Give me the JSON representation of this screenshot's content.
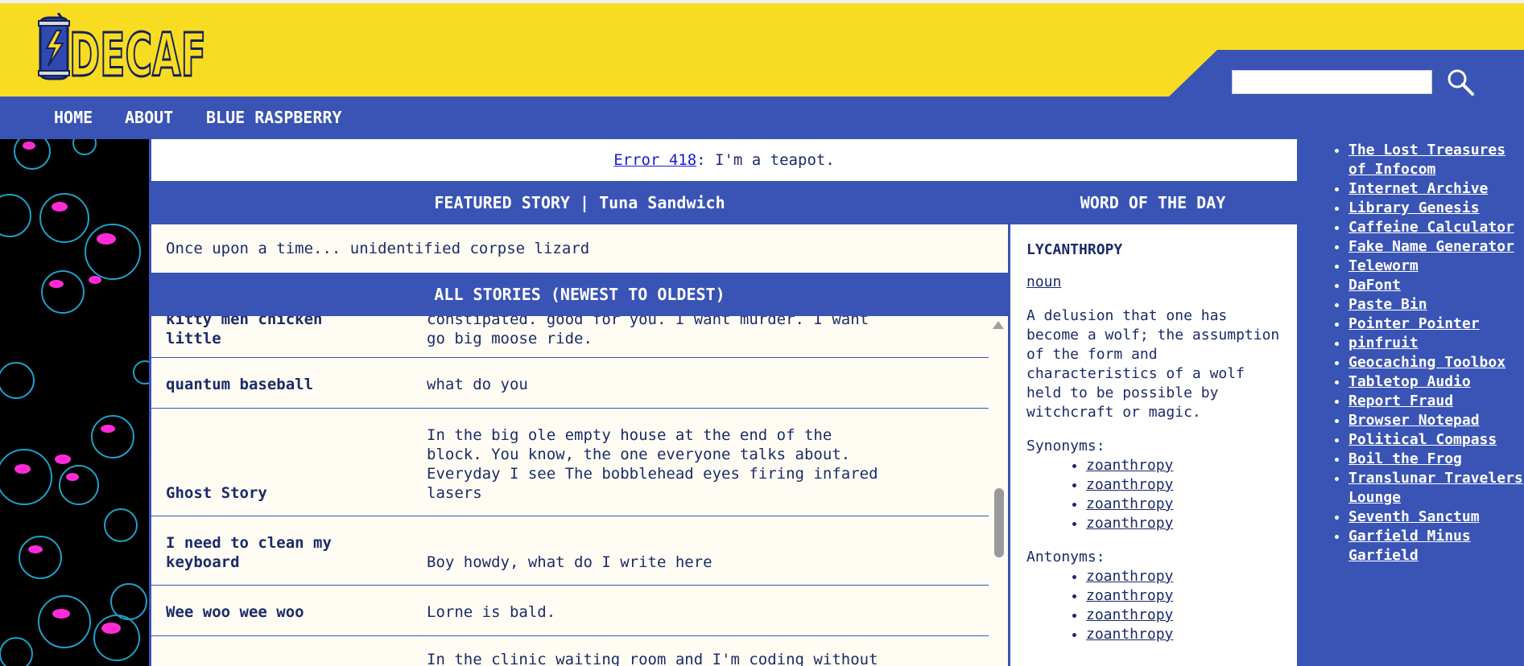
{
  "colors": {
    "yellow": "#f7dc22",
    "blue": "#3a54b5",
    "cream": "#fffdf3",
    "ink": "#1c2a6b"
  },
  "header": {
    "logo_text": "DECAF",
    "search_placeholder": "",
    "search_icon": "search-icon"
  },
  "nav": {
    "items": [
      "HOME",
      "ABOUT",
      "BLUE RASPBERRY"
    ]
  },
  "notice": {
    "link": "Error 418",
    "text": ": I'm a teapot."
  },
  "featured": {
    "heading": "FEATURED STORY | Tuna Sandwich",
    "text": "Once upon a time... unidentified corpse lizard"
  },
  "all_stories": {
    "heading": "ALL STORIES (NEWEST TO OLDEST)",
    "rows": [
      {
        "title": "kitty men chicken\nlittle",
        "text": "constipated. good for you. I want murder. I want\ngo big moose ride."
      },
      {
        "title": "quantum baseball",
        "text": "what do you"
      },
      {
        "title": "Ghost Story",
        "text": "In the big ole empty house at the end of the\nblock. You know, the one everyone talks about.\nEveryday I see The bobblehead eyes firing infared\nlasers"
      },
      {
        "title": "I need to clean my\nkeyboard",
        "text": "Boy howdy, what do I write here"
      },
      {
        "title": "Wee woo wee woo",
        "text": "Lorne is bald."
      },
      {
        "title": "",
        "text": "In the clinic waiting room and I'm coding without"
      }
    ]
  },
  "wotd": {
    "heading": "WORD OF THE DAY",
    "word": "LYCANTHROPY",
    "pos": "noun",
    "definition": "A delusion that one has become a wolf; the assumption of the form and characteristics of a wolf held to be possible by witchcraft or magic.",
    "synonyms_label": "Synonyms:",
    "synonyms": [
      "zoanthropy",
      "zoanthropy",
      "zoanthropy",
      "zoanthropy"
    ],
    "antonyms_label": "Antonyms:",
    "antonyms": [
      "zoanthropy",
      "zoanthropy",
      "zoanthropy",
      "zoanthropy"
    ]
  },
  "links": [
    "The Lost Treasures of Infocom",
    "Internet Archive",
    "Library Genesis",
    "Caffeine Calculator",
    "Fake Name Generator",
    "Teleworm",
    "DaFont",
    "Paste Bin",
    "Pointer Pointer",
    "pinfruit",
    "Geocaching Toolbox",
    "Tabletop Audio",
    "Report Fraud",
    "Browser Notepad",
    "Political Compass",
    "Boil the Frog",
    "Translunar Travelers Lounge",
    "Seventh Sanctum",
    "Garfield Minus Garfield"
  ]
}
